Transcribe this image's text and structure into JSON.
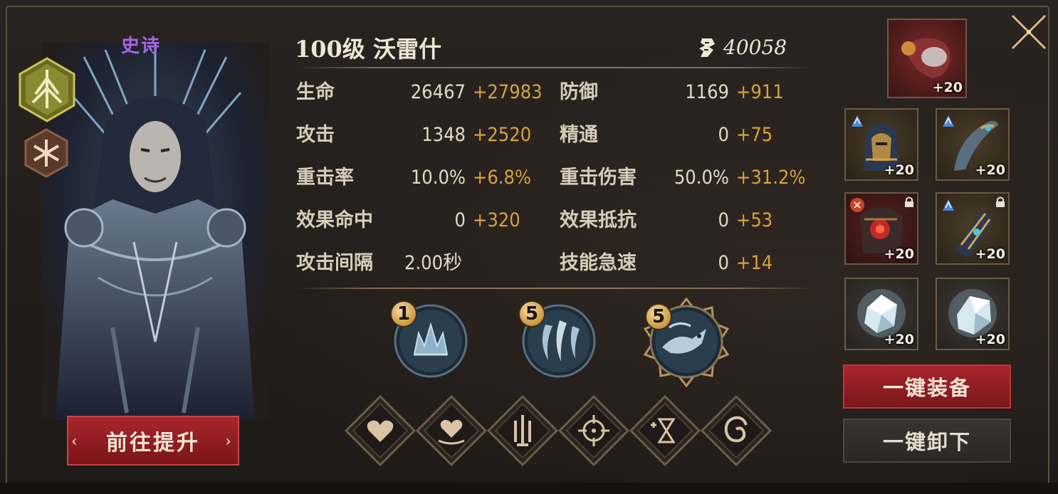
{
  "hero": {
    "rarity": "史诗",
    "title": "100级 沃雷什",
    "power": "40058",
    "goto_button": "前往提升"
  },
  "stats": [
    {
      "label": "生命",
      "base": "26467",
      "bonus": "+27983"
    },
    {
      "label": "防御",
      "base": "1169",
      "bonus": "+911"
    },
    {
      "label": "攻击",
      "base": "1348",
      "bonus": "+2520"
    },
    {
      "label": "精通",
      "base": "0",
      "bonus": "+75"
    },
    {
      "label": "重击率",
      "base": "10.0%",
      "bonus": "+6.8%"
    },
    {
      "label": "重击伤害",
      "base": "50.0%",
      "bonus": "+31.2%"
    },
    {
      "label": "效果命中",
      "base": "0",
      "bonus": "+320"
    },
    {
      "label": "效果抵抗",
      "base": "0",
      "bonus": "+53"
    },
    {
      "label": "攻击间隔",
      "base": "2.00秒",
      "bonus": ""
    },
    {
      "label": "技能急速",
      "base": "0",
      "bonus": "+14"
    }
  ],
  "skills": [
    {
      "level": "1",
      "icon": "crown-spikes-icon"
    },
    {
      "level": "5",
      "icon": "claw-slash-icon"
    },
    {
      "level": "5",
      "icon": "dragon-ultimate-icon"
    }
  ],
  "attribute_icons": [
    "heart-icon",
    "heart-heal-icon",
    "swords-icon",
    "crosshair-icon",
    "hourglass-plus-icon",
    "swirl-icon"
  ],
  "equipment": [
    {
      "slot": "weapon",
      "level": "+20",
      "icon": "red-gauntlet-icon"
    },
    {
      "slot": "helmet",
      "level": "+20",
      "icon": "hood-helmet-icon"
    },
    {
      "slot": "blade",
      "level": "+20",
      "icon": "curved-dagger-icon"
    },
    {
      "slot": "armor",
      "level": "+20",
      "icon": "red-armor-icon"
    },
    {
      "slot": "bracer",
      "level": "+20",
      "icon": "bracer-icon"
    },
    {
      "slot": "crystal-1",
      "level": "+20",
      "icon": "crystal-icon"
    },
    {
      "slot": "crystal-2",
      "level": "+20",
      "icon": "crystal-icon"
    }
  ],
  "buttons": {
    "equip_all": "一键装备",
    "unequip_all": "一键卸下"
  },
  "colors": {
    "rarity_epic": "#a566e6",
    "bonus_gold": "#d6a141",
    "button_red": "#a8262c"
  }
}
